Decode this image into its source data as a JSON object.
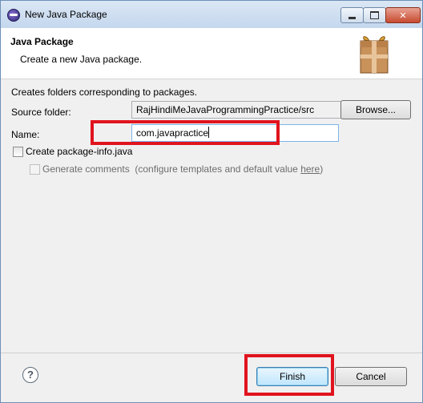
{
  "window": {
    "title": "New Java Package",
    "controls": {
      "minimize": "minimize-icon",
      "maximize": "maximize-icon",
      "close": "close-icon"
    }
  },
  "header": {
    "title": "Java Package",
    "description": "Create a new Java package.",
    "icon": "package-icon"
  },
  "form": {
    "info_text": "Creates folders corresponding to packages.",
    "source_folder_label": "Source folder:",
    "source_folder_value": "RajHindiMeJavaProgrammingPractice/src",
    "browse_label": "Browse...",
    "name_label": "Name:",
    "name_value": "com.javapractice",
    "create_package_info_label": "Create package-info.java",
    "create_package_info_checked": false,
    "generate_comments_label": "Generate comments",
    "generate_comments_note": "(configure templates and default value ",
    "generate_comments_link": "here",
    "generate_comments_note_end": ")",
    "generate_comments_enabled": false
  },
  "footer": {
    "help_symbol": "?",
    "finish_label": "Finish",
    "cancel_label": "Cancel"
  },
  "annotations": {
    "highlight_color": "#e0141e"
  }
}
